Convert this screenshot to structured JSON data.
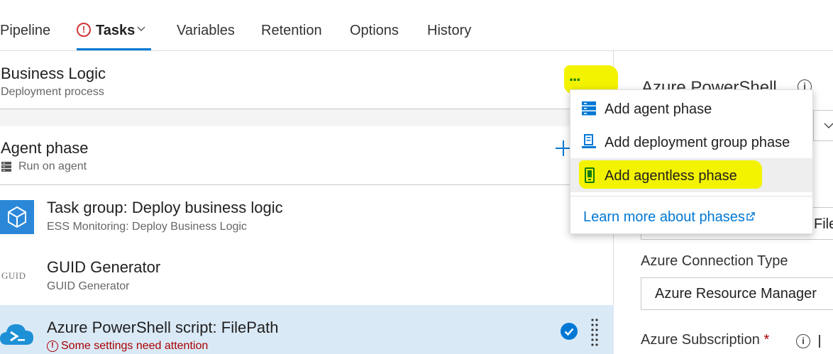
{
  "tabs": [
    {
      "label": "Pipeline"
    },
    {
      "label": "Tasks",
      "has_error": true,
      "active": true
    },
    {
      "label": "Variables"
    },
    {
      "label": "Retention"
    },
    {
      "label": "Options"
    },
    {
      "label": "History"
    }
  ],
  "process": {
    "title": "Business Logic",
    "subtitle": "Deployment process",
    "more_label": "..."
  },
  "phase": {
    "title": "Agent phase",
    "subtitle": "Run on agent"
  },
  "tasks": [
    {
      "title": "Task group: Deploy business logic",
      "subtitle": "ESS Monitoring: Deploy Business Logic",
      "icon": "task-group-icon"
    },
    {
      "title": "GUID Generator",
      "subtitle": "GUID Generator",
      "icon_text": "GUID"
    },
    {
      "title": "Azure PowerShell script: FilePath",
      "warning": "Some settings need attention",
      "icon": "azure-powershell-icon",
      "selected": true
    }
  ],
  "menu": {
    "items": [
      {
        "label": "Add agent phase",
        "icon": "server-icon"
      },
      {
        "label": "Add deployment group phase",
        "icon": "deployment-group-icon"
      },
      {
        "label": "Add agentless phase",
        "icon": "agentless-icon"
      }
    ],
    "link": "Learn more about phases"
  },
  "right_panel": {
    "title": "Azure PowerShell",
    "script_type_partial": "File",
    "connection_type_label": "Azure Connection Type",
    "connection_type_value": "Azure Resource Manager",
    "subscription_label": "Azure Subscription",
    "required_mark": "*"
  },
  "colors": {
    "accent": "#0078d4",
    "error": "#a80000",
    "highlight": "#f3f300",
    "selected_row": "#dae9f6"
  }
}
